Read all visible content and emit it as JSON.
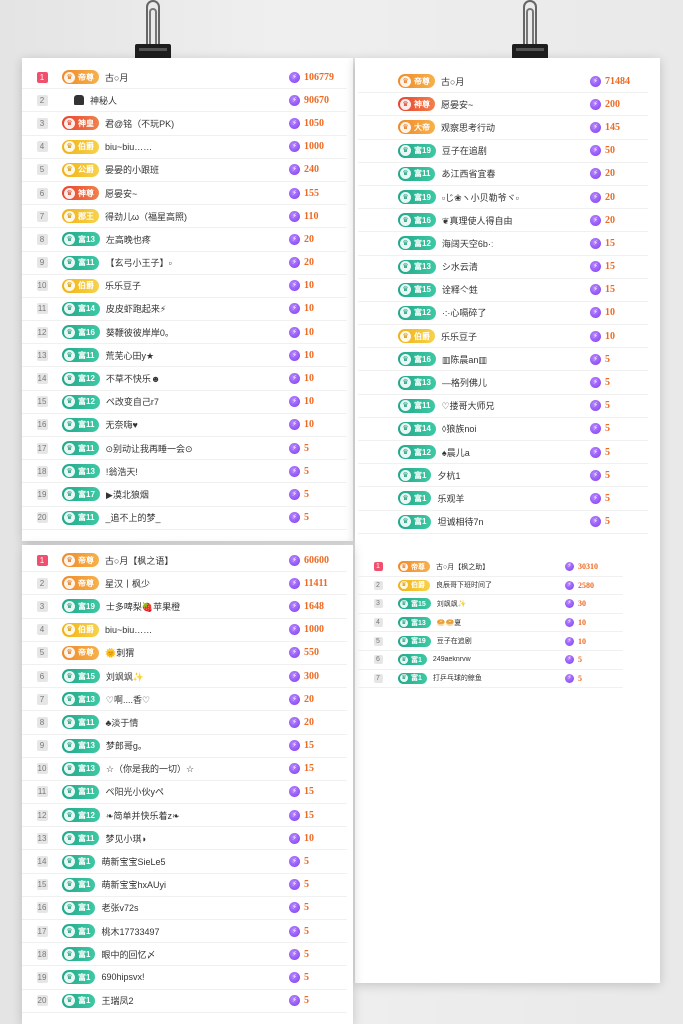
{
  "panels": [
    {
      "rows": [
        {
          "rank": "1",
          "badge": "帝尊",
          "color": "orange",
          "name": "古○月",
          "score": "106779"
        },
        {
          "rank": "2",
          "badge": "",
          "color": "",
          "name": "神秘人",
          "score": "90670",
          "mystery": true
        },
        {
          "rank": "3",
          "badge": "神皇",
          "color": "red",
          "name": "君@铭（不玩PK)",
          "score": "1050"
        },
        {
          "rank": "4",
          "badge": "伯爵",
          "color": "gold",
          "name": "biu~biu……",
          "score": "1000"
        },
        {
          "rank": "5",
          "badge": "公爵",
          "color": "gold",
          "name": "晏晏的小跟班",
          "score": "240"
        },
        {
          "rank": "6",
          "badge": "神尊",
          "color": "red",
          "name": "愿晏安~",
          "score": "155"
        },
        {
          "rank": "7",
          "badge": "郡王",
          "color": "gold",
          "name": "得劲儿ω（福星高照)",
          "score": "110"
        },
        {
          "rank": "8",
          "badge": "富13",
          "color": "green",
          "name": "左高晚也疼",
          "score": "20"
        },
        {
          "rank": "9",
          "badge": "富11",
          "color": "green",
          "name": "【玄弓小王子】▫",
          "score": "20"
        },
        {
          "rank": "10",
          "badge": "伯爵",
          "color": "gold",
          "name": "乐乐豆子",
          "score": "10"
        },
        {
          "rank": "11",
          "badge": "富14",
          "color": "green",
          "name": "皮皮虾跑起来⚡",
          "score": "10"
        },
        {
          "rank": "12",
          "badge": "富16",
          "color": "green",
          "name": "葵鞭彼彼岸岸0。",
          "score": "10"
        },
        {
          "rank": "13",
          "badge": "富11",
          "color": "green",
          "name": "荒芜心田y★",
          "score": "10"
        },
        {
          "rank": "14",
          "badge": "富12",
          "color": "green",
          "name": "不草不快乐☻",
          "score": "10"
        },
        {
          "rank": "15",
          "badge": "富12",
          "color": "green",
          "name": "ペ改变自己r7",
          "score": "10"
        },
        {
          "rank": "16",
          "badge": "富11",
          "color": "green",
          "name": "无奈嗨♥",
          "score": "10"
        },
        {
          "rank": "17",
          "badge": "富11",
          "color": "green",
          "name": "⊙别动让我再睡一会⊙",
          "score": "5"
        },
        {
          "rank": "18",
          "badge": "富13",
          "color": "green",
          "name": "!翁浩天!",
          "score": "5"
        },
        {
          "rank": "19",
          "badge": "富17",
          "color": "green",
          "name": "▶漠北狼烟",
          "score": "5"
        },
        {
          "rank": "20",
          "badge": "富11",
          "color": "green",
          "name": "_追不上的梦_",
          "score": "5"
        }
      ]
    },
    {
      "rows": [
        {
          "rank": "",
          "badge": "帝尊",
          "color": "orange",
          "name": "古○月",
          "score": "71484"
        },
        {
          "rank": "",
          "badge": "神尊",
          "color": "red",
          "name": "愿晏安~",
          "score": "200"
        },
        {
          "rank": "",
          "badge": "大帝",
          "color": "orange",
          "name": "观察思考行动",
          "score": "145"
        },
        {
          "rank": "",
          "badge": "富19",
          "color": "green",
          "name": "豆子在追剧",
          "score": "50"
        },
        {
          "rank": "",
          "badge": "富11",
          "color": "green",
          "name": "あ江西省宜春",
          "score": "20"
        },
        {
          "rank": "",
          "badge": "富19",
          "color": "green",
          "name": "▫じ❀ヽ小贝勒爷ヾ▫",
          "score": "20"
        },
        {
          "rank": "",
          "badge": "富16",
          "color": "green",
          "name": "❦真理使人得自由",
          "score": "20"
        },
        {
          "rank": "",
          "badge": "富12",
          "color": "green",
          "name": "海阔天空6b·ː",
          "score": "15"
        },
        {
          "rank": "",
          "badge": "富13",
          "color": "green",
          "name": "シ水云清",
          "score": "15"
        },
        {
          "rank": "",
          "badge": "富15",
          "color": "green",
          "name": "诠释亽甡",
          "score": "15"
        },
        {
          "rank": "",
          "badge": "富12",
          "color": "green",
          "name": "·:·心嗝碎了",
          "score": "10"
        },
        {
          "rank": "",
          "badge": "伯爵",
          "color": "gold",
          "name": "乐乐豆子",
          "score": "10"
        },
        {
          "rank": "",
          "badge": "富16",
          "color": "green",
          "name": "▥陈晨an▥",
          "score": "5"
        },
        {
          "rank": "",
          "badge": "富13",
          "color": "green",
          "name": "—格列佛儿",
          "score": "5"
        },
        {
          "rank": "",
          "badge": "富11",
          "color": "green",
          "name": "♡搂哥大师兄",
          "score": "5"
        },
        {
          "rank": "",
          "badge": "富14",
          "color": "green",
          "name": "◊狼族noi",
          "score": "5"
        },
        {
          "rank": "",
          "badge": "富12",
          "color": "green",
          "name": "♠晨儿a",
          "score": "5"
        },
        {
          "rank": "",
          "badge": "富1",
          "color": "green",
          "name": "夕杭1",
          "score": "5"
        },
        {
          "rank": "",
          "badge": "富1",
          "color": "green",
          "name": "乐观羊",
          "score": "5"
        },
        {
          "rank": "",
          "badge": "富1",
          "color": "green",
          "name": "坦诚相待7n",
          "score": "5"
        }
      ]
    },
    {
      "rows": [
        {
          "rank": "1",
          "badge": "帝尊",
          "color": "orange",
          "name": "古○月【枫之语】",
          "score": "60600"
        },
        {
          "rank": "2",
          "badge": "帝尊",
          "color": "orange",
          "name": "星汉丨枫少",
          "score": "11411"
        },
        {
          "rank": "3",
          "badge": "富19",
          "color": "green",
          "name": "士多啤梨🍓苹果橙",
          "score": "1648"
        },
        {
          "rank": "4",
          "badge": "伯爵",
          "color": "gold",
          "name": "biu~biu……",
          "score": "1000"
        },
        {
          "rank": "5",
          "badge": "帝尊",
          "color": "orange",
          "name": "🌞刺猬",
          "score": "550"
        },
        {
          "rank": "6",
          "badge": "富15",
          "color": "green",
          "name": "刘飒飒✨",
          "score": "300"
        },
        {
          "rank": "7",
          "badge": "富13",
          "color": "green",
          "name": "♡啊....香♡",
          "score": "20"
        },
        {
          "rank": "8",
          "badge": "富11",
          "color": "green",
          "name": "♣淡于情",
          "score": "20"
        },
        {
          "rank": "9",
          "badge": "富13",
          "color": "green",
          "name": "梦郎哥g。",
          "score": "15"
        },
        {
          "rank": "10",
          "badge": "富13",
          "color": "green",
          "name": "☆（你是我的一切）☆",
          "score": "15"
        },
        {
          "rank": "11",
          "badge": "富11",
          "color": "green",
          "name": "ペ阳光小伙yペ",
          "score": "15"
        },
        {
          "rank": "12",
          "badge": "富12",
          "color": "green",
          "name": "❧简单并快乐着z❧",
          "score": "15"
        },
        {
          "rank": "13",
          "badge": "富11",
          "color": "green",
          "name": "梦见小琪◗",
          "score": "10"
        },
        {
          "rank": "14",
          "badge": "富1",
          "color": "green",
          "name": "萌新宝宝SieLe5",
          "score": "5"
        },
        {
          "rank": "15",
          "badge": "富1",
          "color": "green",
          "name": "萌新宝宝hxAUyi",
          "score": "5"
        },
        {
          "rank": "16",
          "badge": "富1",
          "color": "green",
          "name": "老张v72s",
          "score": "5"
        },
        {
          "rank": "17",
          "badge": "富1",
          "color": "green",
          "name": "桃木17733497",
          "score": "5"
        },
        {
          "rank": "18",
          "badge": "富1",
          "color": "green",
          "name": "眼中的回忆〆",
          "score": "5"
        },
        {
          "rank": "19",
          "badge": "富1",
          "color": "green",
          "name": "690hipsvx!",
          "score": "5"
        },
        {
          "rank": "20",
          "badge": "富1",
          "color": "green",
          "name": "王瑞凤2",
          "score": "5"
        }
      ]
    },
    {
      "rows": [
        {
          "rank": "1",
          "badge": "帝尊",
          "color": "orange",
          "name": "古○月【枫之助】",
          "score": "30310"
        },
        {
          "rank": "2",
          "badge": "伯爵",
          "color": "gold",
          "name": "良辰哥下班时间了",
          "score": "2580"
        },
        {
          "rank": "3",
          "badge": "富15",
          "color": "green",
          "name": "刘飒飒✨",
          "score": "30"
        },
        {
          "rank": "4",
          "badge": "富13",
          "color": "green",
          "name": "🥯🥯夏",
          "score": "10"
        },
        {
          "rank": "5",
          "badge": "富19",
          "color": "green",
          "name": "豆子在追剧",
          "score": "10"
        },
        {
          "rank": "6",
          "badge": "富1",
          "color": "green",
          "name": "249aeknrvw",
          "score": "5"
        },
        {
          "rank": "7",
          "badge": "富1",
          "color": "green",
          "name": "打乒乓球的鲸鱼",
          "score": "5"
        }
      ]
    }
  ],
  "mystery_icon": "incognito-icon",
  "badge_icon": "crown-icon",
  "coin_icon": "lightning-coin-icon",
  "colors": {
    "accent": "#ec6a23",
    "green": "#21a88a",
    "orange": "#f08a2a",
    "gold": "#f2b215",
    "red": "#e8452e",
    "rank1": "#f0506e"
  }
}
